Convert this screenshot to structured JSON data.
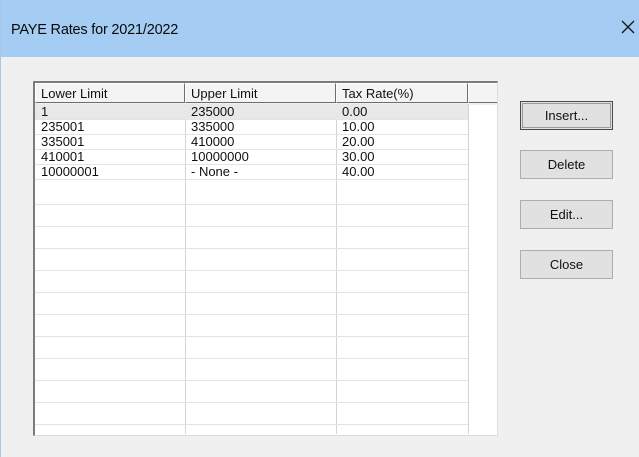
{
  "window": {
    "title": "PAYE Rates for 2021/2022",
    "close_glyph": "✕"
  },
  "table": {
    "columns": [
      "Lower Limit",
      "Upper Limit",
      "Tax Rate(%)",
      ""
    ],
    "rows": [
      [
        "1",
        "235000",
        "0.00"
      ],
      [
        "235001",
        "335000",
        "10.00"
      ],
      [
        "335001",
        "410000",
        "20.00"
      ],
      [
        "410001",
        "10000000",
        "30.00"
      ],
      [
        "10000001",
        "- None -",
        "40.00"
      ]
    ]
  },
  "buttons": {
    "insert": "Insert...",
    "delete": "Delete",
    "edit": "Edit...",
    "close": "Close"
  },
  "icons": {
    "close": "close-icon"
  },
  "colors": {
    "titlebar": "#a5cdf3",
    "dialog_bg": "#f0f0f0",
    "selected_row": "#e8e8e8"
  }
}
